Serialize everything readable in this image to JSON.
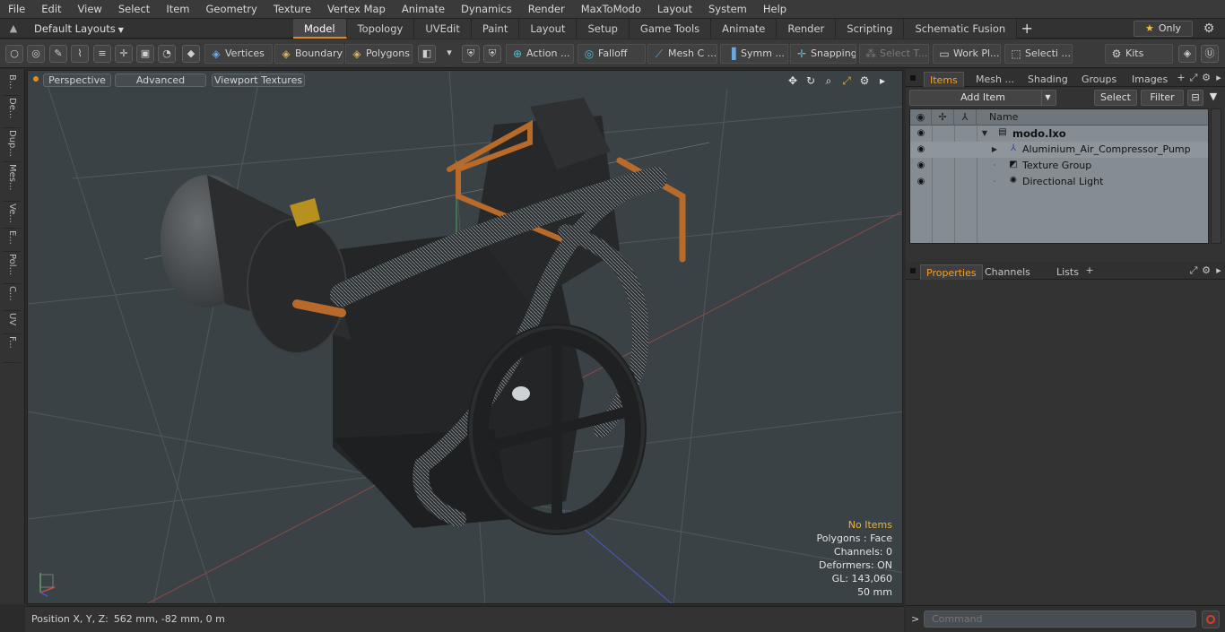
{
  "menu": [
    "File",
    "Edit",
    "View",
    "Select",
    "Item",
    "Geometry",
    "Texture",
    "Vertex Map",
    "Animate",
    "Dynamics",
    "Render",
    "MaxToModo",
    "Layout",
    "System",
    "Help"
  ],
  "layout": {
    "current": "Default Layouts",
    "tabs": [
      "Model",
      "Topology",
      "UVEdit",
      "Paint",
      "Layout",
      "Setup",
      "Game Tools",
      "Animate",
      "Render",
      "Scripting",
      "Schematic Fusion"
    ],
    "active_tab": "Model",
    "only_label": "Only"
  },
  "toolbar": {
    "vertices": "Vertices",
    "boundary": "Boundary",
    "polygons": "Polygons",
    "action": "Action ...",
    "falloff": "Falloff",
    "mesh": "Mesh C ...",
    "symm": "Symm ...",
    "snapping": "Snapping",
    "select_t": "Select T...",
    "work_plane": "Work Pl...",
    "selecti": "Selecti ...",
    "kits": "Kits"
  },
  "left_tabs": [
    "B...",
    "De...",
    "Dup...",
    "Mes...",
    "Ve...",
    "E...",
    "Pol...",
    "C...",
    "UV",
    "F..."
  ],
  "viewport": {
    "perspective": "Perspective",
    "advanced": "Advanced",
    "viewport_textures": "Viewport Textures",
    "stats": {
      "no_items": "No Items",
      "polygons": "Polygons : Face",
      "channels": "Channels: 0",
      "deformers": "Deformers: ON",
      "gl": "GL: 143,060",
      "scale": "50 mm"
    }
  },
  "status": {
    "position_label": "Position X, Y, Z:",
    "position_value": "562 mm, -82 mm, 0 m"
  },
  "items_panel": {
    "tabs": [
      "Items",
      "Mesh ...",
      "Shading",
      "Groups",
      "Images"
    ],
    "active_tab": "Items",
    "add_item": "Add Item",
    "select": "Select",
    "filter": "Filter",
    "column_name": "Name",
    "tree": [
      {
        "label": "modo.lxo",
        "icon": "scene-icon"
      },
      {
        "label": "Aluminium_Air_Compressor_Pump",
        "icon": "mesh-locator-icon"
      },
      {
        "label": "Texture Group",
        "icon": "texture-group-icon"
      },
      {
        "label": "Directional Light",
        "icon": "light-icon"
      }
    ]
  },
  "props_panel": {
    "tabs": [
      "Properties",
      "Channels",
      "Lists"
    ],
    "active_tab": "Properties"
  },
  "command": {
    "placeholder": "Command"
  },
  "colors": {
    "accent": "#e08a26",
    "viewport_bg": "#3b4246",
    "list_bg": "#868d92",
    "copper_pipe": "#b86a2a"
  }
}
